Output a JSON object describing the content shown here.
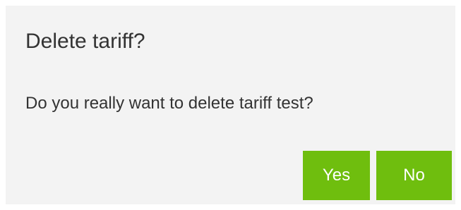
{
  "dialog": {
    "title": "Delete tariff?",
    "message": "Do you really want to delete tariff test?",
    "buttons": {
      "yes_label": "Yes",
      "no_label": "No"
    }
  },
  "colors": {
    "dialog_background": "#f3f3f3",
    "button_background": "#6fbe0e",
    "button_text": "#ffffff",
    "text": "#333333"
  }
}
